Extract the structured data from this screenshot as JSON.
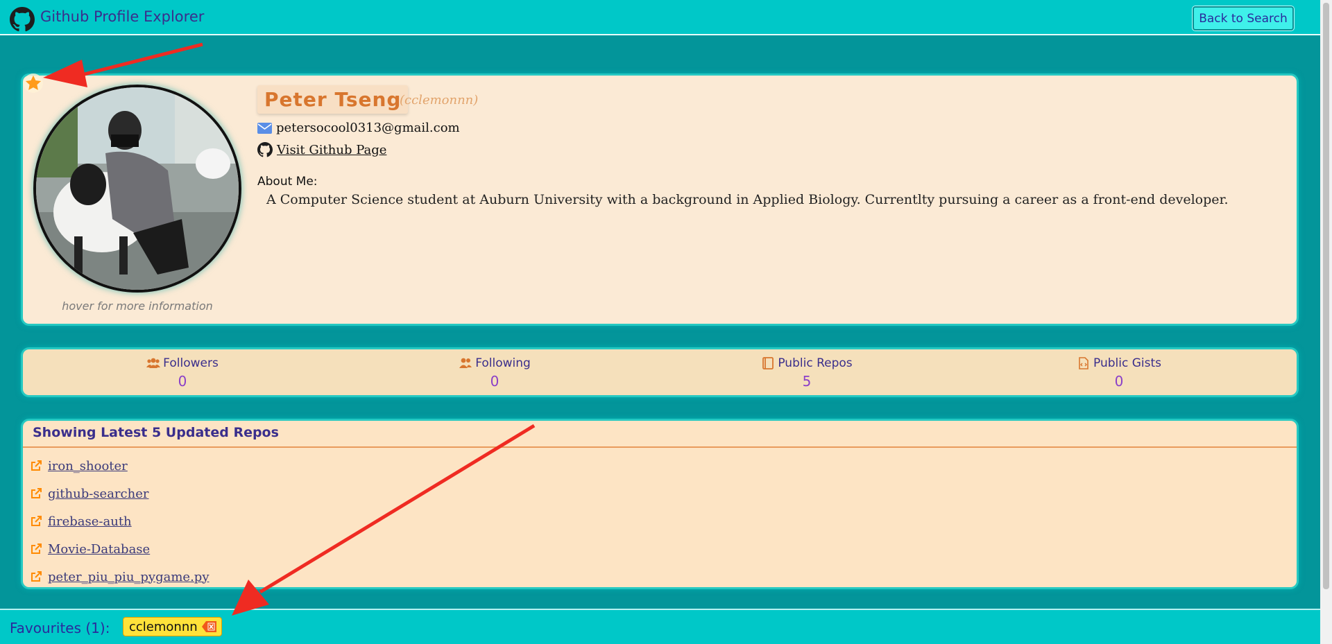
{
  "header": {
    "title": "Github Profile Explorer",
    "back_label": "Back to Search"
  },
  "profile": {
    "name": "Peter Tseng",
    "username": "(cclemonnn)",
    "email": "petersocool0313@gmail.com",
    "github_link": "Visit Github Page",
    "about_label": "About Me:",
    "about_text": "A Computer Science student at Auburn University with a background in Applied Biology. Currentlty pursuing a career as a front-end developer.",
    "avatar_hint": "hover for more information",
    "favourited": true
  },
  "stats": [
    {
      "label": "Followers",
      "value": "0",
      "icon": "followers-icon"
    },
    {
      "label": "Following",
      "value": "0",
      "icon": "following-icon"
    },
    {
      "label": "Public Repos",
      "value": "5",
      "icon": "repo-book-icon"
    },
    {
      "label": "Public Gists",
      "value": "0",
      "icon": "gist-file-icon"
    }
  ],
  "repos": {
    "header": "Showing Latest 5 Updated Repos",
    "items": [
      "iron_shooter",
      "github-searcher",
      "firebase-auth",
      "Movie-Database",
      "peter_piu_piu_pygame.py"
    ]
  },
  "footer": {
    "fav_label": "Favourites (1):",
    "favourites": [
      "cclemonnn"
    ]
  },
  "colors": {
    "accent": "#00c8c8",
    "background": "#03959a",
    "card": "#fbead5",
    "name": "#d8762e",
    "stat_value": "#8a3fc8",
    "arrow": "#ef2b22",
    "star": "#ff9b1a"
  }
}
